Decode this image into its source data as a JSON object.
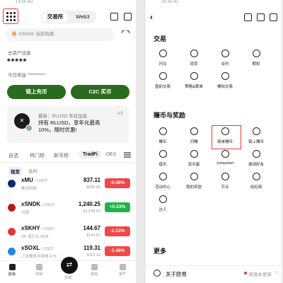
{
  "status_left": "14:36 4G",
  "left": {
    "segment": [
      "交易所",
      "Web3"
    ],
    "search_placeholder": "XSNDK 当前热搜",
    "total_asset_label": "总资产估值",
    "total_asset_value": "*****",
    "today_label": "今日收益 **********",
    "buttons": [
      "链上充币",
      "C2C 买币"
    ],
    "promo": {
      "line1": "最新：RLUSD 年化加息",
      "line2": "持有 RLUSD，享年化最高 10%，限时优惠!",
      "page": "4/9"
    },
    "tabs": [
      "自选",
      "热门榜",
      "新币榜",
      "TradFi",
      "DEX"
    ],
    "sub_tabs": [
      "现货",
      "合约"
    ],
    "rows": [
      {
        "sym": "xMU",
        "quote": "/ USDT",
        "desc": "美光科技",
        "price": "837.11",
        "sprice": "$836.06",
        "chg": "-0.58%",
        "color": "#f04848",
        "coin": "#0d2c6b"
      },
      {
        "sym": "xSNDK",
        "quote": "/ USDT",
        "desc": "闪迪",
        "price": "1,240.25",
        "sprice": "$1,238.69",
        "chg": "+0.23%",
        "color": "#22b24c",
        "coin": "#b71c1c"
      },
      {
        "sym": "xSKHY",
        "quote": "/ USDT",
        "desc": "SK 海力士 ADR",
        "price": "144.67",
        "sprice": "$144.67",
        "chg": "-1.33%",
        "color": "#f04848",
        "coin": "#e53935"
      },
      {
        "sym": "xSOXL",
        "quote": "/ USDT",
        "desc": "三倍做多半导体 ETF",
        "price": "119.31",
        "sprice": "$119.16",
        "chg": "-2.48%",
        "color": "#f04848",
        "coin": "#1e88e5"
      }
    ],
    "nav": [
      "欧易",
      "市场",
      "交易",
      "发现",
      "资产"
    ]
  },
  "right": {
    "sections": [
      "交易",
      "赚币与奖励",
      "更多"
    ],
    "trade_items": [
      "闪兑",
      "现货",
      "合约",
      "期权",
      "盘前交易",
      "策略&跟单",
      "模拟交易"
    ],
    "earn_items": [
      "赚币",
      "闪赚",
      "简单赚币",
      "链上赚币",
      "借币",
      "双币赢",
      "Jumpstart",
      "邀请好友",
      "活动中心",
      "我的奖励",
      "节点",
      "经纪商",
      "达人"
    ],
    "about_label": "关于欧易",
    "about_right": "新版本更新"
  }
}
